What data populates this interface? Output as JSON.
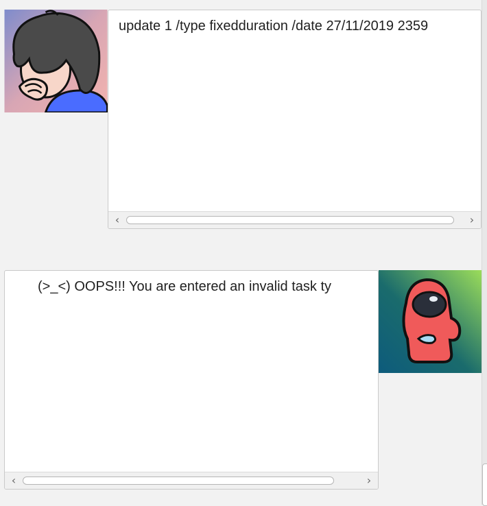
{
  "dialog": {
    "user": {
      "avatar": "user-avatar",
      "message": "update 1 /type fixedduration /date 27/11/2019 2359"
    },
    "bot": {
      "avatar": "bot-avatar",
      "message": "(>_<) OOPS!!! You are entered an invalid task ty"
    }
  },
  "icons": {
    "scroll_left": "‹",
    "scroll_right": "›"
  }
}
